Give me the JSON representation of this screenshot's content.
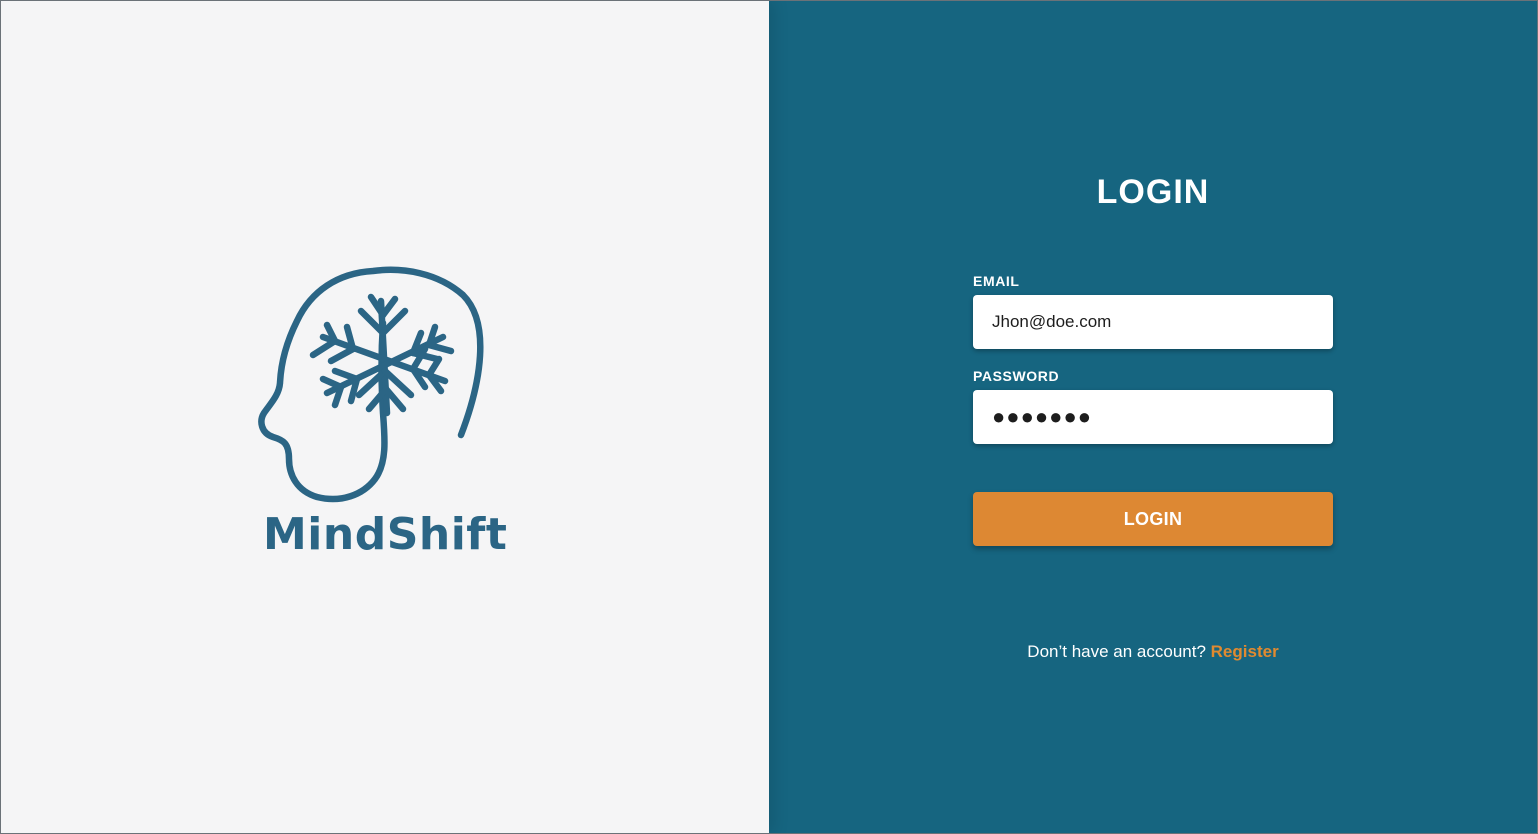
{
  "brand": {
    "name": "MindShift",
    "logo_icon": "head-with-snowflake-icon",
    "color": "#2b6585"
  },
  "login": {
    "title": "LOGIN",
    "email_label": "EMAIL",
    "email_value": "Jhon@doe.com",
    "password_label": "PASSWORD",
    "password_value": "●●●●●●●",
    "button_label": "LOGIN",
    "register_prompt": "Don’t have an account?",
    "register_link": "Register"
  },
  "colors": {
    "left_background": "#f5f5f6",
    "right_background": "#166580",
    "accent": "#dd8833"
  }
}
